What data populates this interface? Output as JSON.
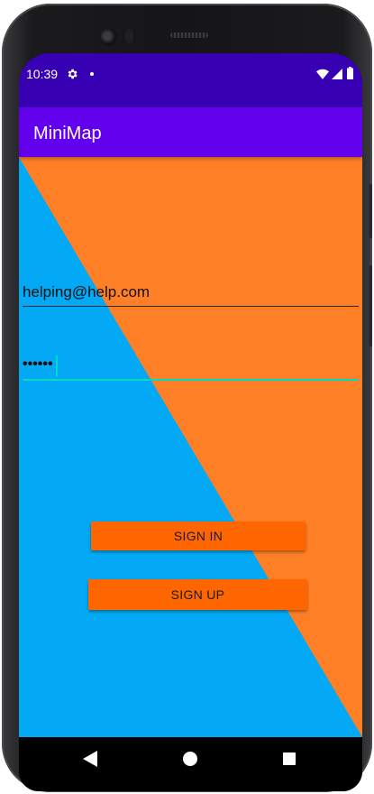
{
  "status_bar": {
    "time": "10:39",
    "background": "#3700b3",
    "icons": [
      "gear-icon",
      "notification-dot-icon",
      "wifi-icon",
      "signal-icon",
      "battery-icon"
    ]
  },
  "app_bar": {
    "title": "MiniMap",
    "background": "#6200ee"
  },
  "background": {
    "left_triangle_color": "#03a9f4",
    "right_region_color": "#ff7f27"
  },
  "form": {
    "email_value": "helping@help.com",
    "password_value": "••••••",
    "focused_field": "password",
    "accent_color": "#03dac5"
  },
  "buttons": {
    "sign_in_label": "SIGN IN",
    "sign_up_label": "SIGN UP",
    "color": "#ff6600"
  },
  "nav_bar": {
    "icons": [
      "back-icon",
      "home-icon",
      "recents-icon"
    ]
  }
}
